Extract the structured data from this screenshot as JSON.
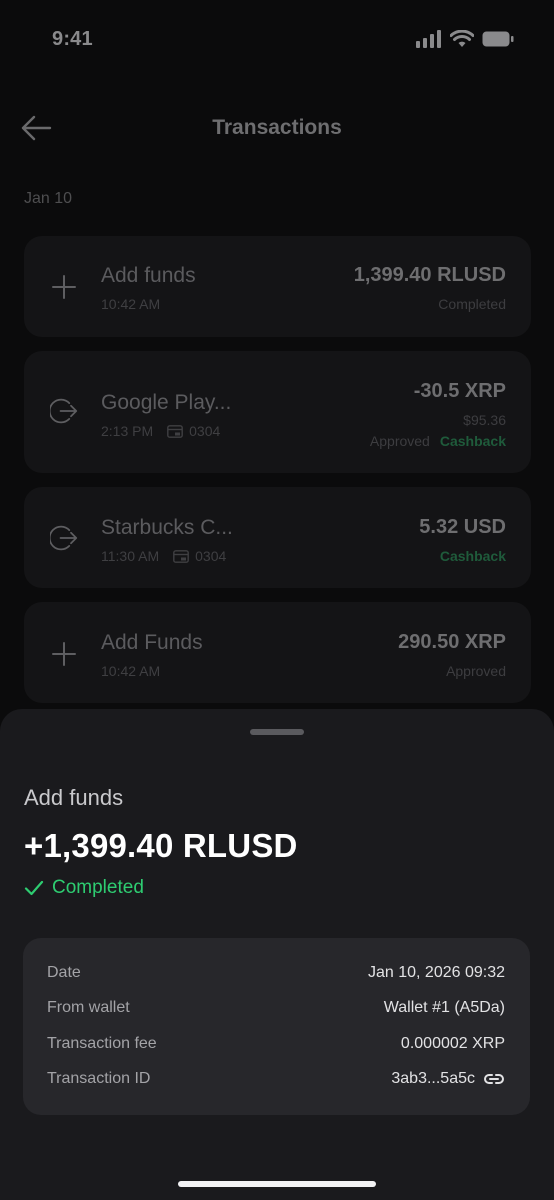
{
  "status_bar": {
    "time": "9:41",
    "icons": [
      "signal-icon",
      "wifi-icon",
      "battery-icon"
    ]
  },
  "header": {
    "title": "Transactions",
    "back_icon": "arrow-left-icon"
  },
  "list": {
    "date": "Jan 10",
    "transactions": [
      {
        "icon": "plus-icon",
        "name": "Add funds",
        "time": "10:42 AM",
        "card": "",
        "amount": "1,399.40 RLUSD",
        "fiat": "",
        "status": "Completed",
        "cashback": ""
      },
      {
        "icon": "outgoing-icon",
        "name": "Google Play...",
        "time": "2:13 PM",
        "card": "0304",
        "amount": "-30.5 XRP",
        "fiat": "$95.36",
        "status": "Approved",
        "cashback": "Cashback"
      },
      {
        "icon": "outgoing-icon",
        "name": "Starbucks C...",
        "time": "11:30 AM",
        "card": "0304",
        "amount": "5.32 USD",
        "fiat": "",
        "status": "",
        "cashback": "Cashback"
      },
      {
        "icon": "plus-icon",
        "name": "Add Funds",
        "time": "10:42 AM",
        "card": "",
        "amount": "290.50 XRP",
        "fiat": "",
        "status": "Approved",
        "cashback": ""
      }
    ]
  },
  "sheet": {
    "title": "Add funds",
    "amount": "+1,399.40 RLUSD",
    "status": "Completed",
    "details": [
      {
        "key": "Date",
        "value": "Jan 10, 2026 09:32"
      },
      {
        "key": "From wallet",
        "value": "Wallet #1 (A5Da)"
      },
      {
        "key": "Transaction fee",
        "value": "0.000002 XRP"
      },
      {
        "key": "Transaction ID",
        "value": "3ab3...5a5c"
      }
    ]
  },
  "colors": {
    "background": "#0b0b0c",
    "sheet": "#1a1a1d",
    "success": "#2ecc71",
    "cashback": "#1f5b3b"
  }
}
